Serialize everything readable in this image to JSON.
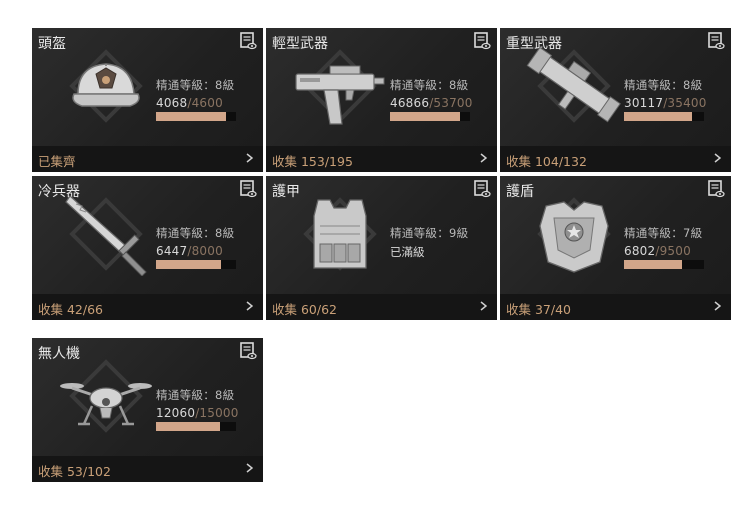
{
  "cards": [
    {
      "title": "頭盔",
      "level_label": "精通等級：8級",
      "exp_current": "4068",
      "exp_max": "/4600",
      "progress": 0.88,
      "footer": "已集齊",
      "icon": "cap-helmet-icon"
    },
    {
      "title": "輕型武器",
      "level_label": "精通等級：8級",
      "exp_current": "46866",
      "exp_max": "/53700",
      "progress": 0.87,
      "footer": "收集 153/195",
      "icon": "submachine-gun-icon"
    },
    {
      "title": "重型武器",
      "level_label": "精通等級：8級",
      "exp_current": "30117",
      "exp_max": "/35400",
      "progress": 0.85,
      "footer": "收集 104/132",
      "icon": "rocket-launcher-icon"
    },
    {
      "title": "冷兵器",
      "level_label": "精通等級：8級",
      "exp_current": "6447",
      "exp_max": "/8000",
      "progress": 0.81,
      "footer": "收集 42/66",
      "icon": "sword-icon"
    },
    {
      "title": "護甲",
      "level_label": "精通等級：9級",
      "maxed_label": "已滿級",
      "footer": "收集 60/62",
      "icon": "vest-armor-icon"
    },
    {
      "title": "護盾",
      "level_label": "精通等級：7級",
      "exp_current": "6802",
      "exp_max": "/9500",
      "progress": 0.72,
      "footer": "收集 37/40",
      "icon": "shield-chestplate-icon"
    },
    {
      "title": "無人機",
      "level_label": "精通等級：8級",
      "exp_current": "12060",
      "exp_max": "/15000",
      "progress": 0.8,
      "footer": "收集 53/102",
      "icon": "drone-icon"
    }
  ],
  "colors": {
    "card_bg": "#232323",
    "footer_bg": "#151515",
    "accent": "#c9a078",
    "bar_fill": "#d2a68a",
    "exp_max": "#8a7462"
  }
}
